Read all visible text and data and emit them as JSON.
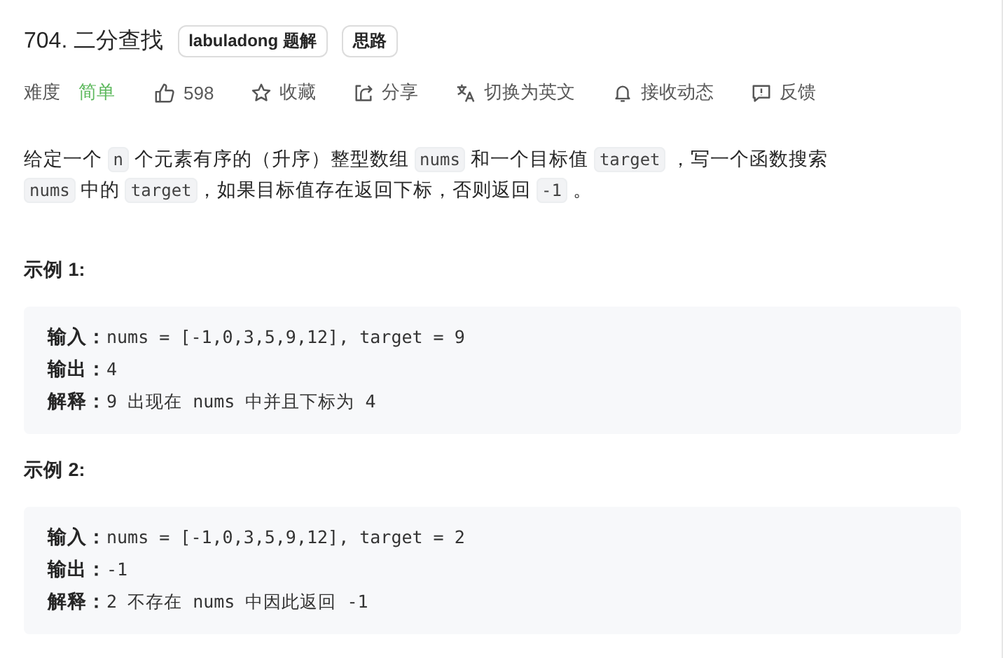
{
  "problem": {
    "title": "704. 二分查找",
    "tags": [
      "labuladong 题解",
      "思路"
    ]
  },
  "meta": {
    "difficulty_label": "难度",
    "difficulty": "简单",
    "actions": [
      {
        "kind": "like",
        "label": "598"
      },
      {
        "kind": "star",
        "label": "收藏"
      },
      {
        "kind": "share",
        "label": "分享"
      },
      {
        "kind": "translate",
        "label": "切换为英文"
      },
      {
        "kind": "bell",
        "label": "接收动态"
      },
      {
        "kind": "feedback",
        "label": "反馈"
      }
    ]
  },
  "description": [
    {
      "kind": "text",
      "text": "给定一个 "
    },
    {
      "kind": "code",
      "text": "n"
    },
    {
      "kind": "text",
      "text": " 个元素有序的（升序）整型数组 "
    },
    {
      "kind": "code",
      "text": "nums"
    },
    {
      "kind": "text",
      "text": " 和一个目标值 "
    },
    {
      "kind": "code",
      "text": "target"
    },
    {
      "kind": "text",
      "text": " ，写一个函数搜索 "
    },
    {
      "kind": "code",
      "text": "nums"
    },
    {
      "kind": "text",
      "text": " 中的 "
    },
    {
      "kind": "code",
      "text": "target"
    },
    {
      "kind": "text",
      "text": "，如果目标值存在返回下标，否则返回 "
    },
    {
      "kind": "code",
      "text": "-1"
    },
    {
      "kind": "text",
      "text": " 。"
    }
  ],
  "examples": [
    {
      "title": "示例 1:",
      "lines": [
        {
          "label": "输入：",
          "text": "nums = [-1,0,3,5,9,12], target = 9"
        },
        {
          "label": "输出：",
          "text": "4"
        },
        {
          "label": "解释：",
          "text": "9 出现在 nums 中并且下标为 4"
        }
      ]
    },
    {
      "title": "示例 2:",
      "lines": [
        {
          "label": "输入：",
          "text": "nums = [-1,0,3,5,9,12], target = 2"
        },
        {
          "label": "输出：",
          "text": "-1"
        },
        {
          "label": "解释：",
          "text": "2 不存在 nums 中因此返回 -1"
        }
      ]
    }
  ]
}
